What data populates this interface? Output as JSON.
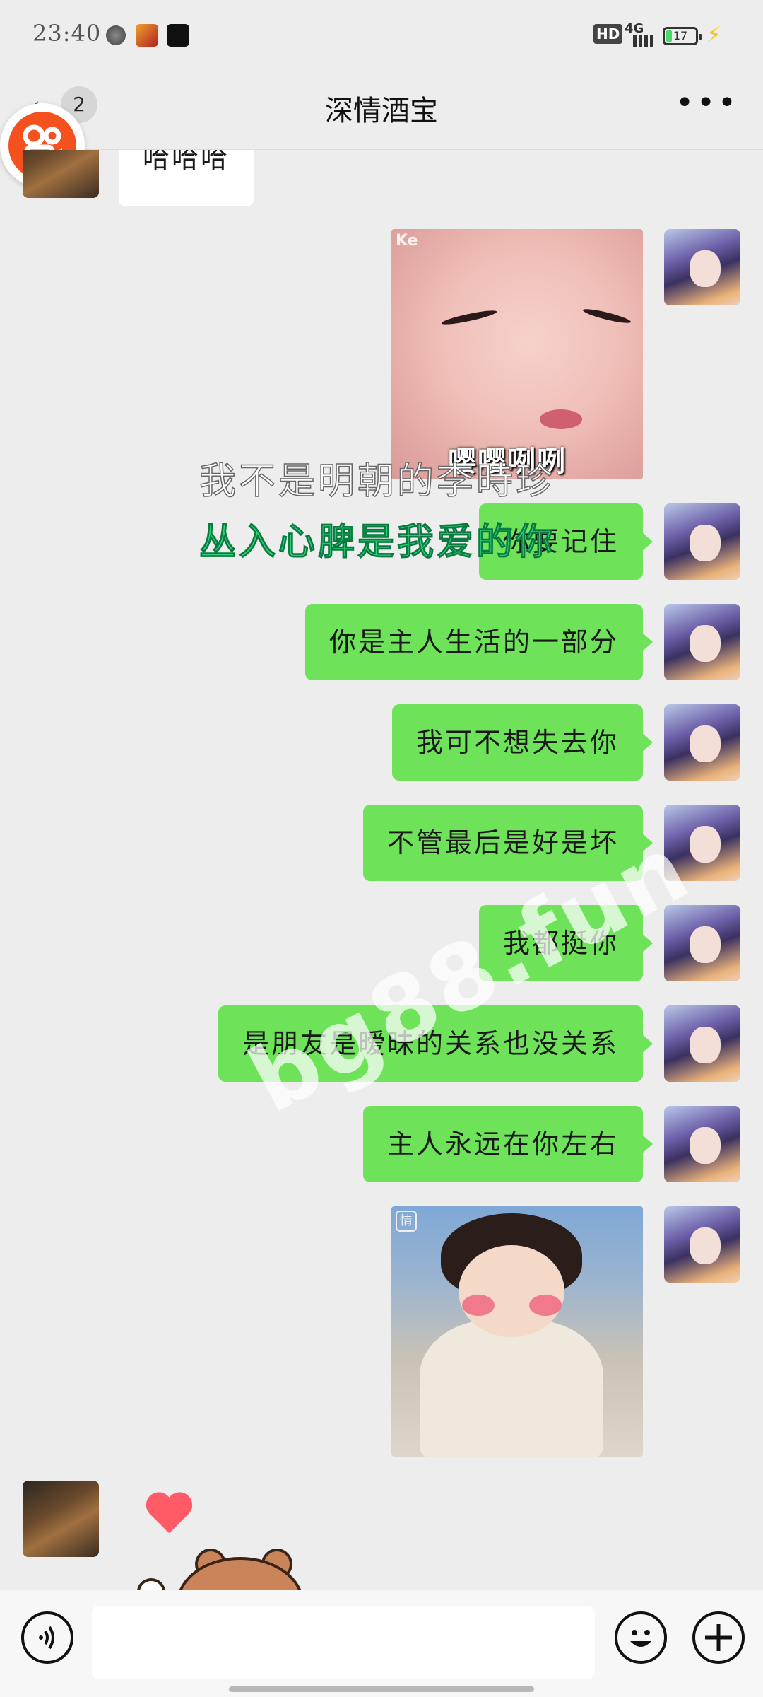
{
  "status_bar": {
    "time": "23:40",
    "hd_label": "HD",
    "network_label": "4G",
    "battery_level": "17"
  },
  "header": {
    "back_icon": "chevron-left-icon",
    "unread_count": "2",
    "title": "深情酒宝",
    "more_label": "•••"
  },
  "messages": [
    {
      "direction": "in",
      "text": "哈哈哈"
    },
    {
      "direction": "out",
      "type": "sticker",
      "caption": "嘤嘤咧咧",
      "corner_mark": "Ke"
    },
    {
      "direction": "out",
      "text": "你要记住"
    },
    {
      "direction": "out",
      "text": "你是主人生活的一部分"
    },
    {
      "direction": "out",
      "text": "我可不想失去你"
    },
    {
      "direction": "out",
      "text": "不管最后是好是坏"
    },
    {
      "direction": "out",
      "text": "我都挺你"
    },
    {
      "direction": "out",
      "text": "是朋友是暧昧的关系也没关系"
    },
    {
      "direction": "out",
      "text": "主人永远在你左右"
    },
    {
      "direction": "out",
      "type": "sticker",
      "corner_mark": "情"
    },
    {
      "direction": "in",
      "type": "sticker",
      "description": "bear-with-heart"
    }
  ],
  "overlay": {
    "line1": "我不是明朝的李時珍",
    "line2": "丛入心脾是我爱的你"
  },
  "watermark": "bg88.fun",
  "input_bar": {
    "voice_icon": "voice-icon",
    "emoji_icon": "emoji-icon",
    "plus_icon": "plus-icon",
    "input_value": ""
  },
  "colors": {
    "outgoing_bubble": "#6ee35a",
    "incoming_bubble": "#ffffff",
    "background": "#ededed"
  }
}
